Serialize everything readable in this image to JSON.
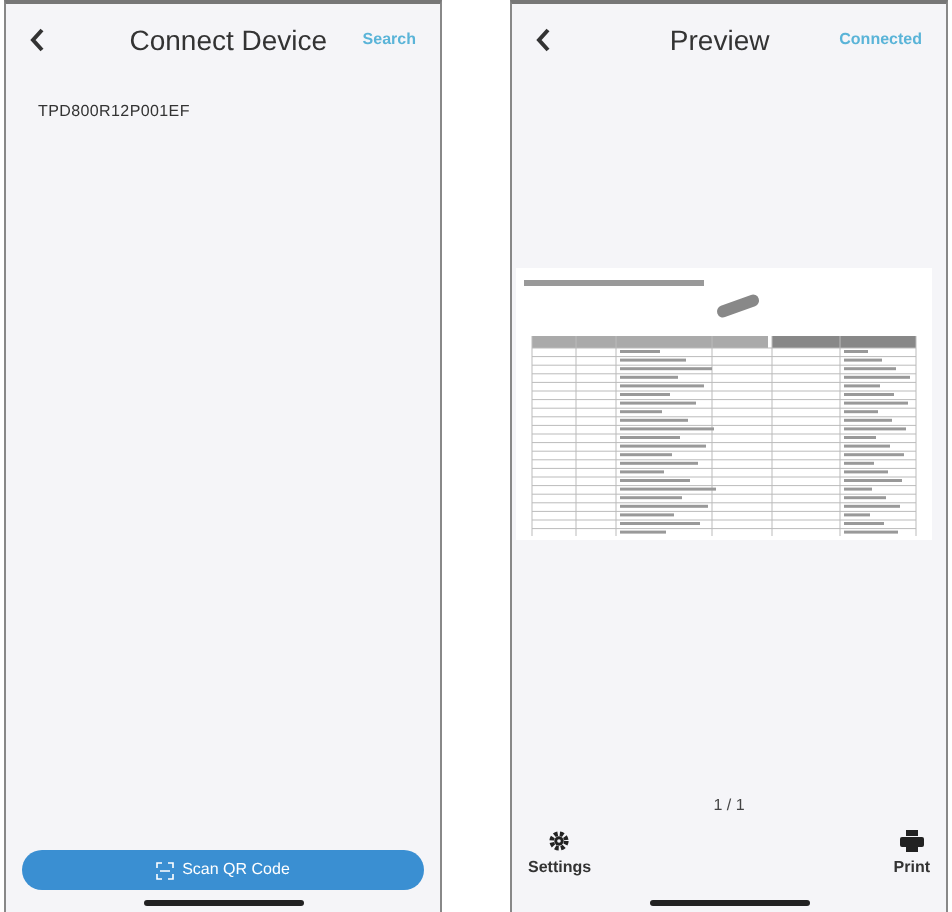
{
  "screens": [
    {
      "kind": "connect",
      "title": "Connect Device",
      "action": "Search",
      "devices": [
        "TPD800R12P001EF"
      ],
      "scan_button": "Scan QR Code"
    },
    {
      "kind": "preview",
      "title": "Preview",
      "action": "Connected",
      "page_indicator": "1 / 1",
      "toolbar": [
        {
          "kind": "settings",
          "label": "Settings"
        },
        {
          "kind": "print",
          "label": "Print"
        }
      ]
    }
  ]
}
